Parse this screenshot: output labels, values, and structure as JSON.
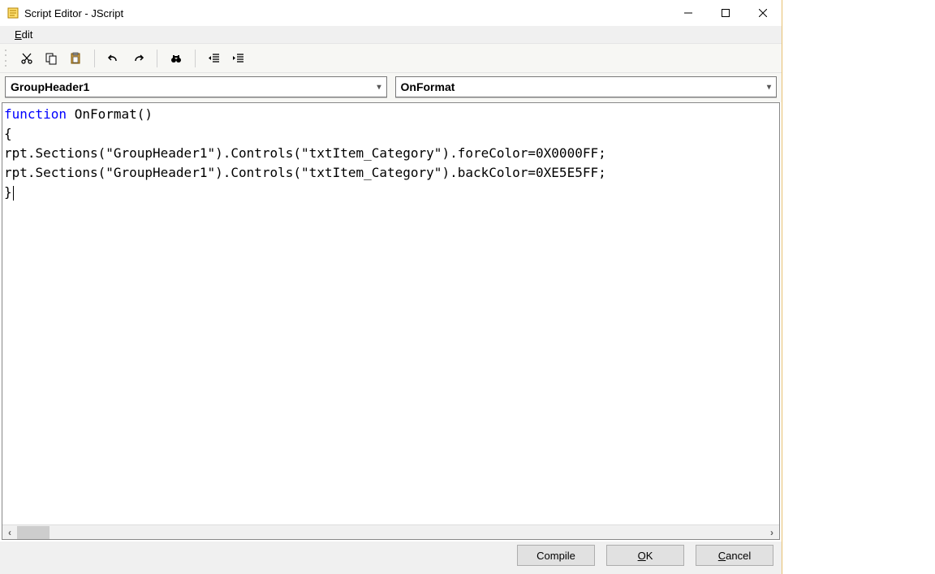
{
  "window": {
    "title": "Script Editor - JScript"
  },
  "menu": {
    "edit": "Edit"
  },
  "toolbar": {
    "cut": "cut",
    "copy": "copy",
    "paste": "paste",
    "undo": "undo",
    "redo": "redo",
    "find": "find",
    "outdent": "outdent",
    "indent": "indent"
  },
  "dropdowns": {
    "section": "GroupHeader1",
    "event": "OnFormat"
  },
  "code": {
    "keyword": "function",
    "line1_rest": " OnFormat()",
    "line2": "{",
    "line3": "rpt.Sections(\"GroupHeader1\").Controls(\"txtItem_Category\").foreColor=0X0000FF;",
    "line4": "rpt.Sections(\"GroupHeader1\").Controls(\"txtItem_Category\").backColor=0XE5E5FF;",
    "line5": "}"
  },
  "buttons": {
    "compile": "Compile",
    "ok": "OK",
    "cancel": "Cancel"
  }
}
